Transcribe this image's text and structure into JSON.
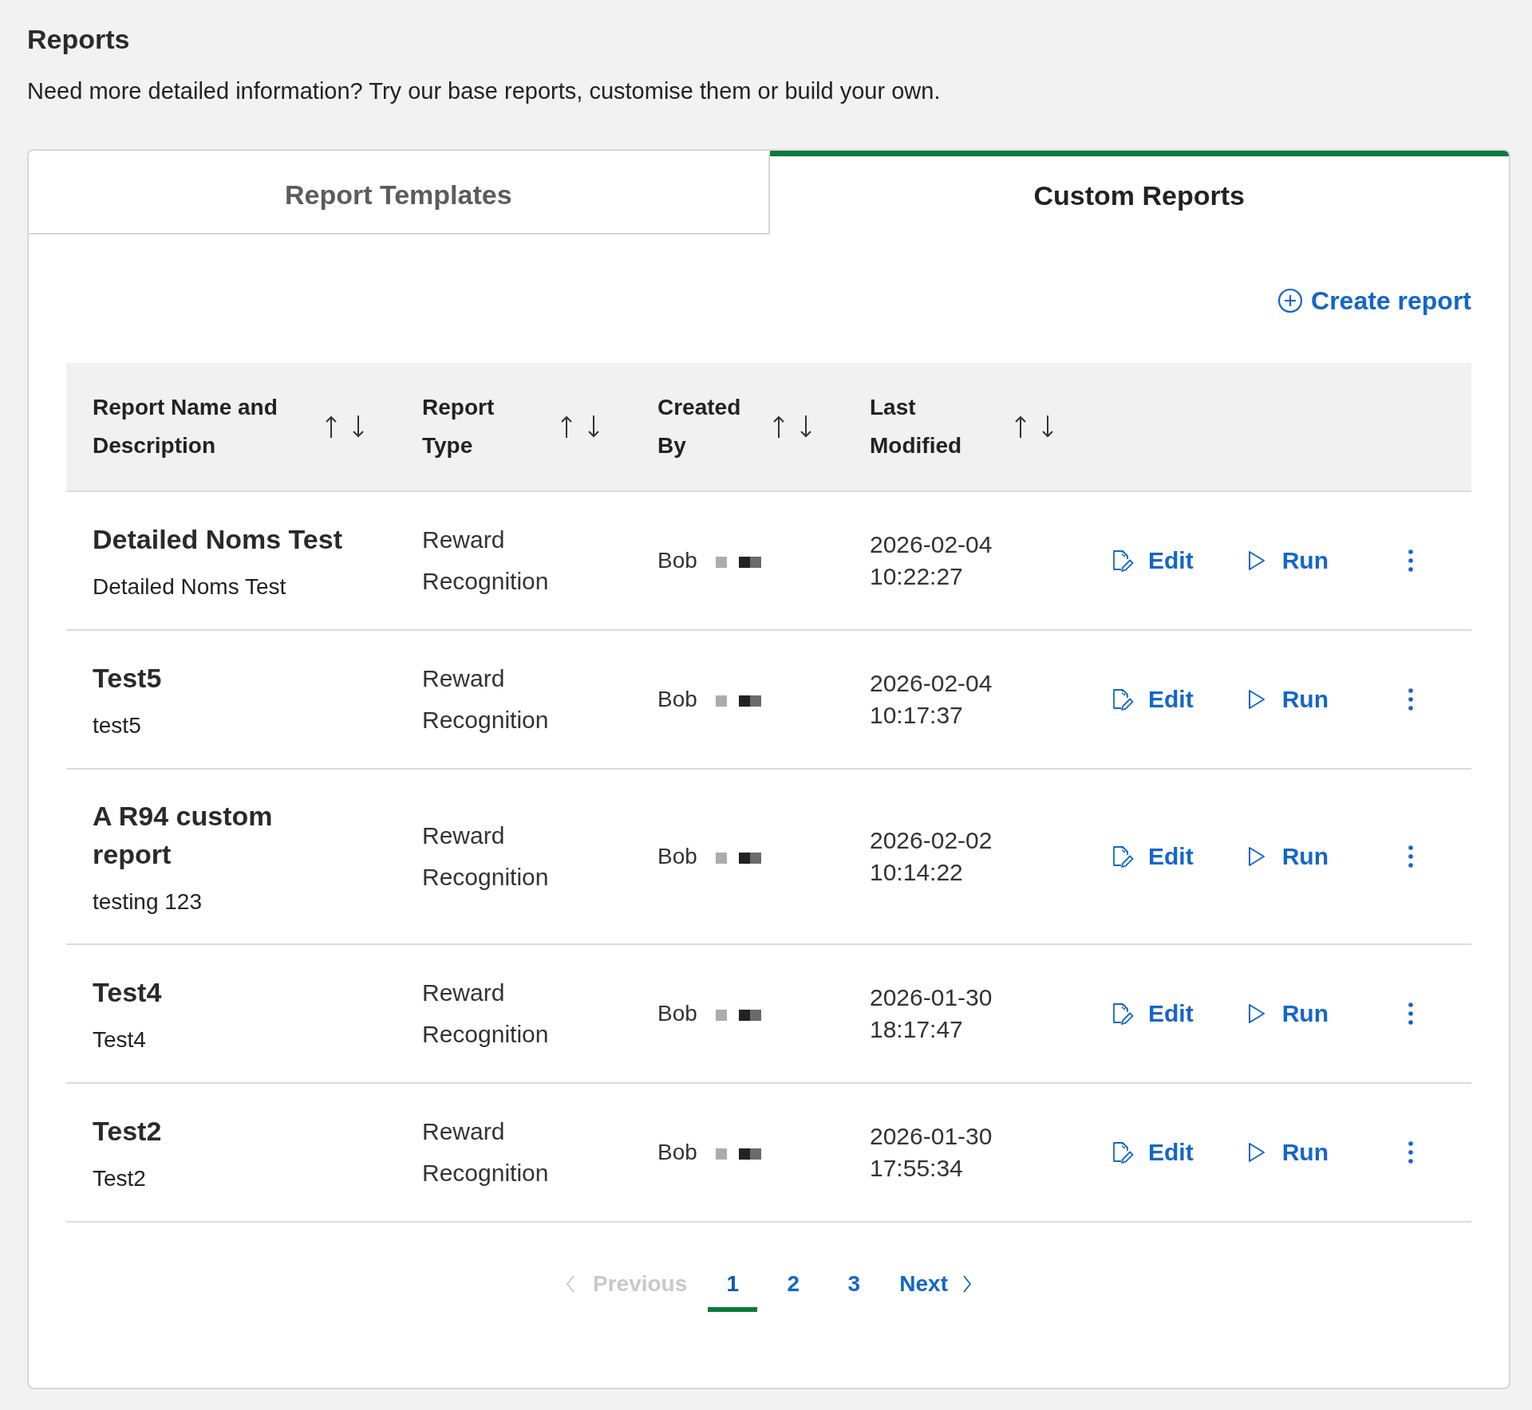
{
  "page": {
    "title": "Reports",
    "description": "Need more detailed information? Try our base reports, customise them or build your own."
  },
  "tabs": [
    {
      "label": "Report Templates",
      "selected": false
    },
    {
      "label": "Custom Reports",
      "selected": true
    }
  ],
  "create_button": {
    "label": "Create report"
  },
  "table": {
    "columns": [
      {
        "label": "Report Name and Description"
      },
      {
        "label": "Report Type"
      },
      {
        "label": "Created By"
      },
      {
        "label": "Last Modified"
      }
    ],
    "rows": [
      {
        "name": "Detailed Noms Test",
        "description": "Detailed Noms Test",
        "report_type": "Reward Recognition",
        "created_by": "Bob",
        "last_modified": "2026-02-04 10:22:27",
        "actions": [
          {
            "kind": "edit",
            "label": "Edit"
          },
          {
            "kind": "run",
            "label": "Run"
          },
          {
            "kind": "more"
          }
        ]
      },
      {
        "name": "Test5",
        "description": "test5",
        "report_type": "Reward Recognition",
        "created_by": "Bob",
        "last_modified": "2026-02-04 10:17:37",
        "actions": [
          {
            "kind": "edit",
            "label": "Edit"
          },
          {
            "kind": "run",
            "label": "Run"
          },
          {
            "kind": "more"
          }
        ]
      },
      {
        "name": "A R94 custom report",
        "description": "testing 123",
        "report_type": "Reward Recognition",
        "created_by": "Bob",
        "last_modified": "2026-02-02 10:14:22",
        "actions": [
          {
            "kind": "edit",
            "label": "Edit"
          },
          {
            "kind": "run",
            "label": "Run"
          },
          {
            "kind": "more"
          }
        ]
      },
      {
        "name": "Test4",
        "description": "Test4",
        "report_type": "Reward Recognition",
        "created_by": "Bob",
        "last_modified": "2026-01-30 18:17:47",
        "actions": [
          {
            "kind": "edit",
            "label": "Edit"
          },
          {
            "kind": "run",
            "label": "Run"
          },
          {
            "kind": "more"
          }
        ]
      },
      {
        "name": "Test2",
        "description": "Test2",
        "report_type": "Reward Recognition",
        "created_by": "Bob",
        "last_modified": "2026-01-30 17:55:34",
        "actions": [
          {
            "kind": "edit",
            "label": "Edit"
          },
          {
            "kind": "run",
            "label": "Run"
          },
          {
            "kind": "more"
          }
        ]
      }
    ]
  },
  "pagination": {
    "previous": {
      "label": "Previous",
      "disabled": true
    },
    "pages": [
      {
        "label": "1",
        "selected": true
      },
      {
        "label": "2",
        "selected": false
      },
      {
        "label": "3",
        "selected": false
      }
    ],
    "next": {
      "label": "Next",
      "disabled": false
    }
  }
}
